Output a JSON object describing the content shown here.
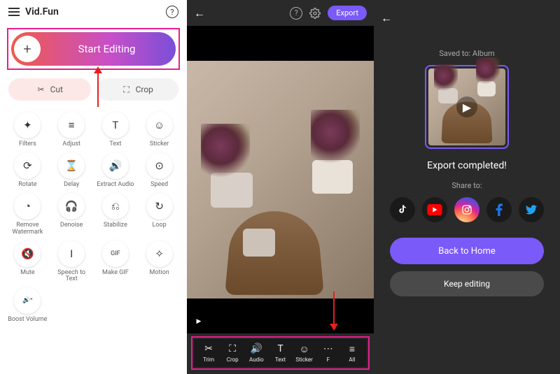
{
  "home": {
    "app_title": "Vid.Fun",
    "start_label": "Start Editing",
    "cut_label": "Cut",
    "crop_label": "Crop",
    "tools": [
      {
        "label": "Filters",
        "icon": "✦"
      },
      {
        "label": "Adjust",
        "icon": "≡"
      },
      {
        "label": "Text",
        "icon": "T"
      },
      {
        "label": "Sticker",
        "icon": "☺"
      },
      {
        "label": "Rotate",
        "icon": "⟳"
      },
      {
        "label": "Delay",
        "icon": "⌛"
      },
      {
        "label": "Extract Audio",
        "icon": "🔊"
      },
      {
        "label": "Speed",
        "icon": "⊙"
      },
      {
        "label": "Remove Watermark",
        "icon": "◔"
      },
      {
        "label": "Denoise",
        "icon": "🎧"
      },
      {
        "label": "Stabilize",
        "icon": "⎌"
      },
      {
        "label": "Loop",
        "icon": "↻"
      },
      {
        "label": "Mute",
        "icon": "🔇"
      },
      {
        "label": "Speech to Text",
        "icon": "I"
      },
      {
        "label": "Make GIF",
        "icon": "GIF"
      },
      {
        "label": "Motion",
        "icon": "✧"
      },
      {
        "label": "Boost Volume",
        "icon": "🔊⁺"
      }
    ]
  },
  "editor": {
    "export_label": "Export",
    "toolbar": [
      {
        "label": "Trim",
        "icon": "✂"
      },
      {
        "label": "Crop",
        "icon": "⛶"
      },
      {
        "label": "Audio",
        "icon": "🔊"
      },
      {
        "label": "Text",
        "icon": "T"
      },
      {
        "label": "Sticker",
        "icon": "☺"
      },
      {
        "label": "F",
        "icon": "⋯"
      },
      {
        "label": "All",
        "icon": "≡"
      }
    ]
  },
  "export": {
    "saved_to": "Saved to: Album",
    "status": "Export completed!",
    "share_to": "Share to:",
    "back_home": "Back to Home",
    "keep_editing": "Keep editing",
    "share_targets": [
      "TikTok",
      "YouTube",
      "Instagram",
      "Facebook",
      "Twitter"
    ]
  }
}
